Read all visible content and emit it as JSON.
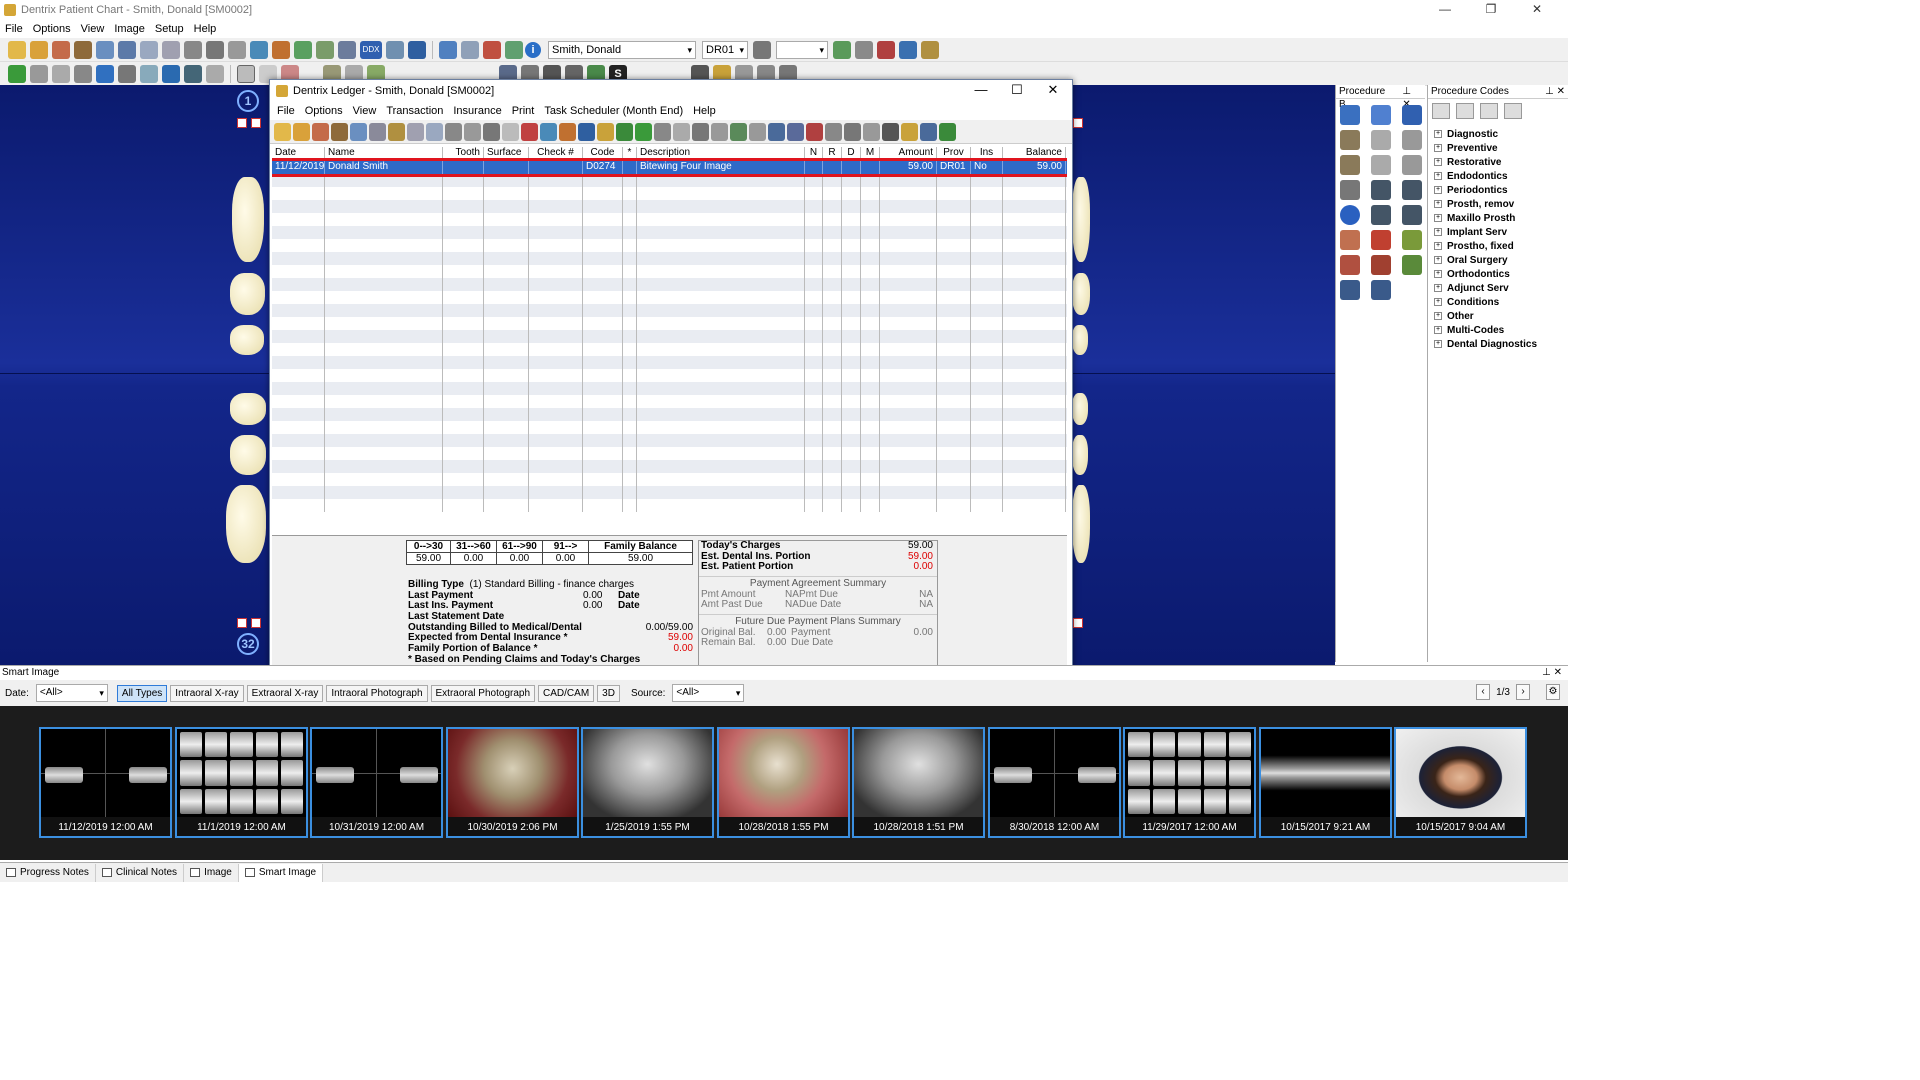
{
  "window": {
    "title": "Dentrix Patient Chart - Smith, Donald [SM0002]",
    "controls": [
      "—",
      "❐",
      "✕"
    ]
  },
  "menu": [
    "File",
    "Options",
    "View",
    "Image",
    "Setup",
    "Help"
  ],
  "toolbar": {
    "patient": "Smith, Donald",
    "provider": "DR01",
    "ddx": "DDX"
  },
  "chart": {
    "tooth_top_left": "1",
    "tooth_bottom_left": "32"
  },
  "procedure_buttons": {
    "title": "Procedure B..."
  },
  "procedure_codes": {
    "title": "Procedure Codes",
    "items": [
      "Diagnostic",
      "Preventive",
      "Restorative",
      "Endodontics",
      "Periodontics",
      "Prosth, remov",
      "Maxillo Prosth",
      "Implant Serv",
      "Prostho, fixed",
      "Oral Surgery",
      "Orthodontics",
      "Adjunct Serv",
      "Conditions",
      "Other",
      "Multi-Codes",
      "Dental Diagnostics"
    ]
  },
  "ledger": {
    "title": "Dentrix Ledger - Smith, Donald [SM0002]",
    "menu": [
      "File",
      "Options",
      "View",
      "Transaction",
      "Insurance",
      "Print",
      "Task Scheduler (Month End)",
      "Help"
    ],
    "columns": [
      "Date",
      "Name",
      "Tooth",
      "Surface",
      "Check #",
      "Code",
      "*",
      "Description",
      "N",
      "R",
      "D",
      "M",
      "Amount",
      "Prov",
      "Ins",
      "Balance"
    ],
    "rows": [
      {
        "date": "11/12/2019",
        "name": "Donald  Smith",
        "tooth": "",
        "surface": "",
        "check": "",
        "code": "D0274",
        "star": "",
        "description": "Bitewing Four Image",
        "n": "",
        "r": "",
        "d": "",
        "m": "",
        "amount": "59.00",
        "prov": "DR01",
        "ins": "No",
        "balance": "59.00"
      }
    ],
    "aging": {
      "headers": [
        "0-->30",
        "31-->60",
        "61-->90",
        "91-->",
        "Family Balance"
      ],
      "values": [
        "59.00",
        "0.00",
        "0.00",
        "0.00",
        "59.00"
      ]
    },
    "billing_type_label": "Billing Type",
    "billing_type_value": "(1) Standard Billing - finance charges",
    "last_payment_label": "Last Payment",
    "last_payment_value": "0.00",
    "last_payment_date": "Date",
    "last_ins_payment_label": "Last Ins. Payment",
    "last_ins_payment_value": "0.00",
    "last_ins_payment_date": "Date",
    "last_statement_label": "Last Statement Date",
    "outstanding_label": "Outstanding Billed to Medical/Dental",
    "outstanding_value": "0.00/59.00",
    "expected_label": "Expected from Dental Insurance *",
    "expected_value": "59.00",
    "family_portion_label": "Family Portion of Balance *",
    "family_portion_value": "0.00",
    "footnote": "* Based on Pending Claims and Today's Charges",
    "todays_charges_label": "Today's Charges",
    "todays_charges_value": "59.00",
    "est_dental_label": "Est. Dental Ins. Portion",
    "est_dental_value": "59.00",
    "est_patient_label": "Est. Patient Portion",
    "est_patient_value": "0.00",
    "pas_title": "Payment Agreement Summary",
    "pas_pmt_amount_label": "Pmt Amount",
    "pas_pmt_amount_value": "NA",
    "pas_pmt_due_label": "Pmt Due",
    "pas_pmt_due_value": "NA",
    "pas_amt_past_due_label": "Amt Past Due",
    "pas_amt_past_due_value": "NA",
    "pas_due_date_label": "Due Date",
    "pas_due_date_value": "NA",
    "fdp_title": "Future Due Payment Plans Summary",
    "fdp_original_label": "Original Bal.",
    "fdp_original_value": "0.00",
    "fdp_payment_label": "Payment",
    "fdp_payment_value": "0.00",
    "fdp_remain_label": "Remain Bal.",
    "fdp_remain_value": "0.00",
    "fdp_due_label": "Due Date"
  },
  "smart_image": {
    "title": "Smart Image",
    "date_label": "Date:",
    "date_value": "<All>",
    "type_buttons": [
      "All Types",
      "Intraoral X-ray",
      "Extraoral X-ray",
      "Intraoral Photograph",
      "Extraoral Photograph",
      "CAD/CAM",
      "3D"
    ],
    "source_label": "Source:",
    "source_value": "<All>",
    "page": "1/3",
    "thumbnails": [
      {
        "caption": "11/12/2019 12:00 AM",
        "kind": "xray-bw"
      },
      {
        "caption": "11/1/2019 12:00 AM",
        "kind": "xray-fmx"
      },
      {
        "caption": "10/31/2019 12:00 AM",
        "kind": "xray-bw"
      },
      {
        "caption": "10/30/2019 2:06 PM",
        "kind": "photo-gold"
      },
      {
        "caption": "1/25/2019 1:55 PM",
        "kind": "xray-gray"
      },
      {
        "caption": "10/28/2018 1:55 PM",
        "kind": "photo-pink"
      },
      {
        "caption": "10/28/2018 1:51 PM",
        "kind": "xray-gray"
      },
      {
        "caption": "8/30/2018 12:00 AM",
        "kind": "xray-bw"
      },
      {
        "caption": "11/29/2017 12:00 AM",
        "kind": "xray-fmx"
      },
      {
        "caption": "10/15/2017 9:21 AM",
        "kind": "pano"
      },
      {
        "caption": "10/15/2017 9:04 AM",
        "kind": "face"
      }
    ]
  },
  "bottom_tabs": [
    "Progress Notes",
    "Clinical Notes",
    "Image",
    "Smart Image"
  ]
}
